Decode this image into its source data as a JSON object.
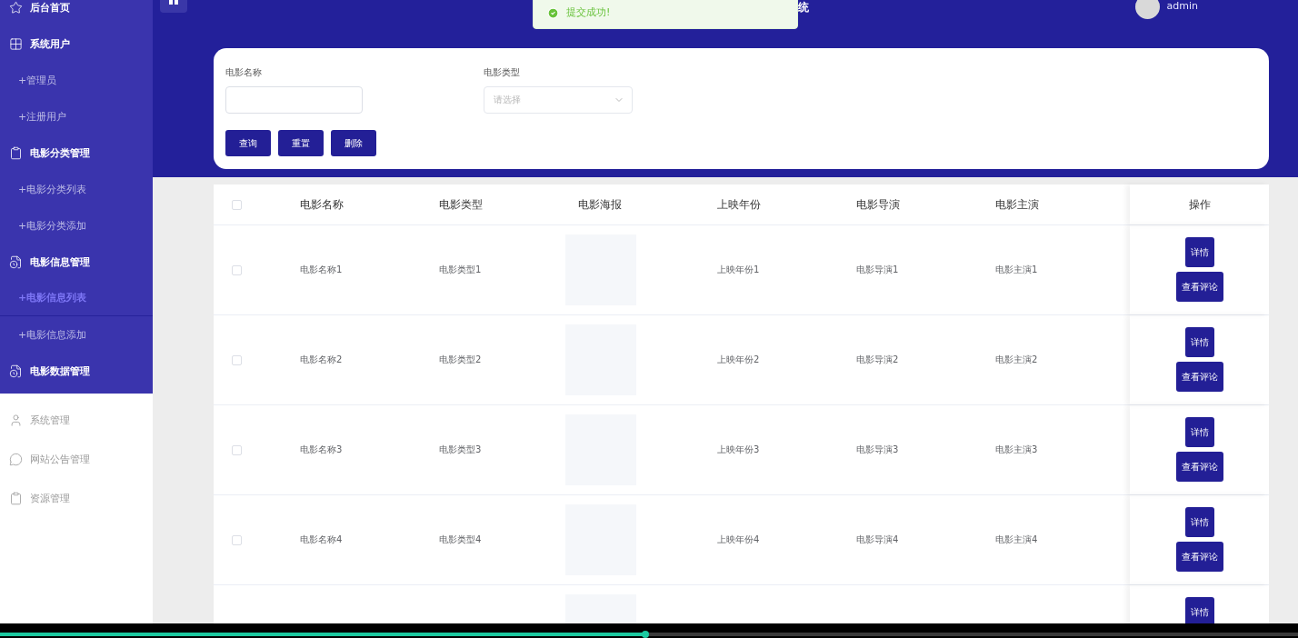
{
  "sidebar": {
    "sections": [
      {
        "open": true,
        "items": [
          {
            "label": "后台首页"
          },
          {
            "label": "系统用户",
            "children": [
              {
                "label": "+管理员",
                "selected": false
              },
              {
                "label": "+注册用户",
                "selected": false
              }
            ]
          },
          {
            "label": "电影分类管理",
            "children": [
              {
                "label": "+电影分类列表",
                "selected": false
              },
              {
                "label": "+电影分类添加",
                "selected": false
              }
            ]
          },
          {
            "label": "电影信息管理",
            "children": [
              {
                "label": "+电影信息列表",
                "selected": true
              },
              {
                "label": "+电影信息添加",
                "selected": false
              }
            ]
          },
          {
            "label": "电影数据管理"
          }
        ]
      },
      {
        "open": false,
        "items": [
          {
            "label": "系统管理"
          },
          {
            "label": "网站公告管理"
          },
          {
            "label": "资源管理"
          }
        ]
      }
    ]
  },
  "header": {
    "title": "统",
    "user": "admin"
  },
  "toast": {
    "message": "提交成功!"
  },
  "search": {
    "fields": [
      {
        "label": "电影名称",
        "kind": "input"
      },
      {
        "label": "电影类型",
        "kind": "select",
        "placeholder": "请选择"
      }
    ],
    "buttons": [
      "查询",
      "重置",
      "删除"
    ]
  },
  "table": {
    "header_checked": false,
    "columns": [
      "电影名称",
      "电影类型",
      "电影海报",
      "上映年份",
      "电影导演",
      "电影主演",
      "操作"
    ],
    "rows": [
      {
        "checked": false,
        "cells": [
          "电影名称1",
          "电影类型1",
          null,
          "上映年份1",
          "电影导演1",
          "电影主演1"
        ],
        "actions": [
          "详情",
          "查看评论"
        ]
      },
      {
        "checked": false,
        "cells": [
          "电影名称2",
          "电影类型2",
          null,
          "上映年份2",
          "电影导演2",
          "电影主演2"
        ],
        "actions": [
          "详情",
          "查看评论"
        ]
      },
      {
        "checked": false,
        "cells": [
          "电影名称3",
          "电影类型3",
          null,
          "上映年份3",
          "电影导演3",
          "电影主演3"
        ],
        "actions": [
          "详情",
          "查看评论"
        ]
      },
      {
        "checked": false,
        "cells": [
          "电影名称4",
          "电影类型4",
          null,
          "上映年份4",
          "电影导演4",
          "电影主演4"
        ],
        "actions": [
          "详情",
          "查看评论"
        ]
      },
      {
        "cells": [],
        "actions": [
          "详情"
        ]
      }
    ]
  },
  "player": {
    "level": 0.497
  }
}
